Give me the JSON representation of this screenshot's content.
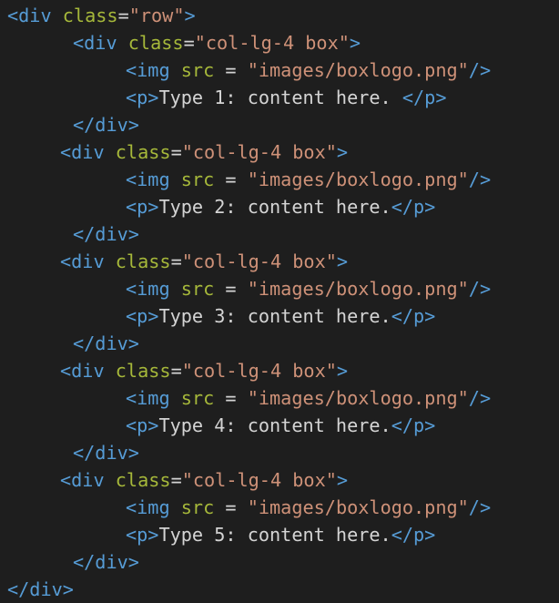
{
  "editor": {
    "background": "#1e1e1e",
    "colors": {
      "tag": "#569cd6",
      "attribute": "#9cdcfe",
      "attribute_green": "#a6b83a",
      "string": "#ce9178",
      "text": "#d4d4d4"
    },
    "lines": [
      {
        "tokens": [
          {
            "t": "tag",
            "v": "<div "
          },
          {
            "t": "attr-green",
            "v": "class"
          },
          {
            "t": "eq",
            "v": "="
          },
          {
            "t": "str",
            "v": "\"row\""
          },
          {
            "t": "tag",
            "v": ">"
          }
        ]
      },
      {
        "tokens": [
          {
            "t": "tag",
            "v": "<div "
          },
          {
            "t": "attr-green",
            "v": "class"
          },
          {
            "t": "eq",
            "v": "="
          },
          {
            "t": "str",
            "v": "\"col-lg-4 box\""
          },
          {
            "t": "tag",
            "v": ">"
          }
        ]
      },
      {
        "tokens": [
          {
            "t": "tag",
            "v": "<img "
          },
          {
            "t": "attr-green",
            "v": "src"
          },
          {
            "t": "eq",
            "v": " = "
          },
          {
            "t": "str",
            "v": "\"images/boxlogo.png\""
          },
          {
            "t": "tag",
            "v": "/>"
          }
        ]
      },
      {
        "tokens": [
          {
            "t": "tag",
            "v": "<p>"
          },
          {
            "t": "text",
            "v": "Type 1: content here. "
          },
          {
            "t": "tag",
            "v": "</p>"
          }
        ]
      },
      {
        "tokens": [
          {
            "t": "tag",
            "v": "</div>"
          }
        ]
      },
      {
        "tokens": [
          {
            "t": "tag",
            "v": "<div "
          },
          {
            "t": "attr-green",
            "v": "class"
          },
          {
            "t": "eq",
            "v": "="
          },
          {
            "t": "str",
            "v": "\"col-lg-4 box\""
          },
          {
            "t": "tag",
            "v": ">"
          }
        ]
      },
      {
        "tokens": [
          {
            "t": "tag",
            "v": "<img "
          },
          {
            "t": "attr-green",
            "v": "src"
          },
          {
            "t": "eq",
            "v": " = "
          },
          {
            "t": "str",
            "v": "\"images/boxlogo.png\""
          },
          {
            "t": "tag",
            "v": "/>"
          }
        ]
      },
      {
        "tokens": [
          {
            "t": "tag",
            "v": "<p>"
          },
          {
            "t": "text",
            "v": "Type 2: content here."
          },
          {
            "t": "tag",
            "v": "</p>"
          }
        ]
      },
      {
        "tokens": [
          {
            "t": "tag",
            "v": "</div>"
          }
        ]
      },
      {
        "tokens": [
          {
            "t": "tag",
            "v": "<div "
          },
          {
            "t": "attr-green",
            "v": "class"
          },
          {
            "t": "eq",
            "v": "="
          },
          {
            "t": "str",
            "v": "\"col-lg-4 box\""
          },
          {
            "t": "tag",
            "v": ">"
          }
        ]
      },
      {
        "tokens": [
          {
            "t": "tag",
            "v": "<img "
          },
          {
            "t": "attr-green",
            "v": "src"
          },
          {
            "t": "eq",
            "v": " = "
          },
          {
            "t": "str",
            "v": "\"images/boxlogo.png\""
          },
          {
            "t": "tag",
            "v": "/>"
          }
        ]
      },
      {
        "tokens": [
          {
            "t": "tag",
            "v": "<p>"
          },
          {
            "t": "text",
            "v": "Type 3: content here."
          },
          {
            "t": "tag",
            "v": "</p>"
          }
        ]
      },
      {
        "tokens": [
          {
            "t": "tag",
            "v": "</div>"
          }
        ]
      },
      {
        "tokens": [
          {
            "t": "tag",
            "v": "<div "
          },
          {
            "t": "attr-green",
            "v": "class"
          },
          {
            "t": "eq",
            "v": "="
          },
          {
            "t": "str",
            "v": "\"col-lg-4 box\""
          },
          {
            "t": "tag",
            "v": ">"
          }
        ]
      },
      {
        "tokens": [
          {
            "t": "tag",
            "v": "<img "
          },
          {
            "t": "attr-green",
            "v": "src"
          },
          {
            "t": "eq",
            "v": " = "
          },
          {
            "t": "str",
            "v": "\"images/boxlogo.png\""
          },
          {
            "t": "tag",
            "v": "/>"
          }
        ]
      },
      {
        "tokens": [
          {
            "t": "tag",
            "v": "<p>"
          },
          {
            "t": "text",
            "v": "Type 4: content here."
          },
          {
            "t": "tag",
            "v": "</p>"
          }
        ]
      },
      {
        "tokens": [
          {
            "t": "tag",
            "v": "</div>"
          }
        ]
      },
      {
        "tokens": [
          {
            "t": "tag",
            "v": "<div "
          },
          {
            "t": "attr-green",
            "v": "class"
          },
          {
            "t": "eq",
            "v": "="
          },
          {
            "t": "str",
            "v": "\"col-lg-4 box\""
          },
          {
            "t": "tag",
            "v": ">"
          }
        ]
      },
      {
        "tokens": [
          {
            "t": "tag",
            "v": "<img "
          },
          {
            "t": "attr-green",
            "v": "src"
          },
          {
            "t": "eq",
            "v": " = "
          },
          {
            "t": "str",
            "v": "\"images/boxlogo.png\""
          },
          {
            "t": "tag",
            "v": "/>"
          }
        ]
      },
      {
        "tokens": [
          {
            "t": "tag",
            "v": "<p>"
          },
          {
            "t": "text",
            "v": "Type 5: content here."
          },
          {
            "t": "tag",
            "v": "</p>"
          }
        ]
      },
      {
        "tokens": [
          {
            "t": "tag",
            "v": "</div>"
          }
        ]
      },
      {
        "tokens": [
          {
            "t": "tag",
            "v": "</div>"
          }
        ]
      }
    ]
  }
}
